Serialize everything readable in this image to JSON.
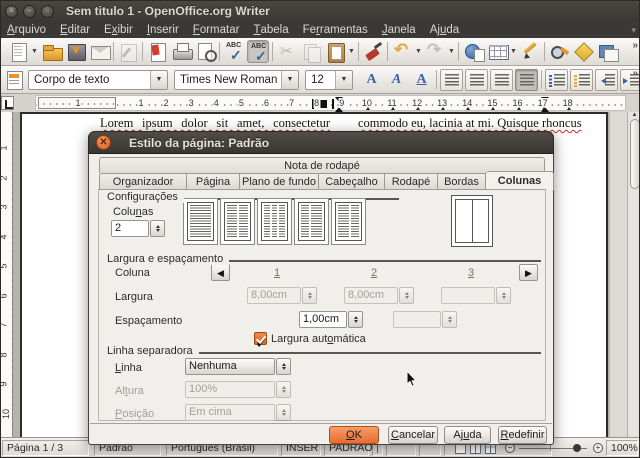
{
  "window": {
    "title": "Sem titulo 1 - OpenOffice.org Writer"
  },
  "colors": {
    "titlebar_background": "#3b3935",
    "accent_orange": "#e9662f",
    "ok_button_orange": "#ee8052",
    "toolbar_icon_blue": "#3465a4",
    "spellcheck_wave_red": "#cc2a1f",
    "dialog_background": "#f1efeb"
  },
  "menubar": {
    "items": [
      {
        "label": "Arquivo",
        "m": 0
      },
      {
        "label": "Editar",
        "m": 0
      },
      {
        "label": "Exibir",
        "m": 1
      },
      {
        "label": "Inserir",
        "m": 0
      },
      {
        "label": "Formatar",
        "m": 0
      },
      {
        "label": "Tabela",
        "m": 0
      },
      {
        "label": "Ferramentas",
        "m": 2
      },
      {
        "label": "Janela",
        "m": 0
      },
      {
        "label": "Ajuda",
        "m": 2
      }
    ]
  },
  "standard_toolbar": {
    "items": [
      {
        "name": "new-document",
        "type": "new",
        "dropdown": true
      },
      {
        "name": "open-document",
        "type": "open"
      },
      {
        "name": "save-document",
        "type": "save"
      },
      {
        "name": "email-document",
        "type": "mail"
      },
      {
        "sep": true
      },
      {
        "name": "edit-file",
        "type": "edit",
        "disabled": true
      },
      {
        "sep": true
      },
      {
        "name": "export-pdf",
        "type": "pdf"
      },
      {
        "name": "print",
        "type": "print"
      },
      {
        "name": "page-preview",
        "type": "preview"
      },
      {
        "sep": true
      },
      {
        "name": "spellcheck",
        "type": "spell"
      },
      {
        "name": "auto-spellcheck",
        "type": "autospell",
        "pressed": true
      },
      {
        "sep": true
      },
      {
        "name": "cut",
        "type": "cut",
        "disabled": true
      },
      {
        "name": "copy",
        "type": "copy",
        "disabled": true
      },
      {
        "name": "paste",
        "type": "paste",
        "dropdown": true
      },
      {
        "sep": true
      },
      {
        "name": "format-paintbrush",
        "type": "brush"
      },
      {
        "sep": true
      },
      {
        "name": "undo",
        "type": "undo",
        "dropdown": true
      },
      {
        "name": "redo",
        "type": "redo",
        "disabled": true,
        "dropdown": true
      },
      {
        "sep": true
      },
      {
        "name": "hyperlink",
        "type": "link"
      },
      {
        "name": "insert-table",
        "type": "table",
        "dropdown": true
      },
      {
        "name": "draw-functions",
        "type": "draw"
      },
      {
        "sep": true
      },
      {
        "name": "find-replace",
        "type": "find"
      },
      {
        "name": "navigator",
        "type": "nav"
      },
      {
        "name": "gallery",
        "type": "gallery"
      }
    ]
  },
  "formatting_toolbar": {
    "style_value": "Corpo de texto",
    "font_value": "Times New Roman",
    "size_value": "12",
    "buttons": [
      {
        "name": "bold",
        "glyph": "A",
        "cls": "b"
      },
      {
        "name": "italic",
        "glyph": "A",
        "cls": "i"
      },
      {
        "name": "underline",
        "glyph": "A",
        "cls": "u"
      },
      {
        "sep": true
      },
      {
        "name": "align-left",
        "cls": "boxed al"
      },
      {
        "name": "align-center",
        "cls": "boxed ac"
      },
      {
        "name": "align-right",
        "cls": "boxed ar"
      },
      {
        "name": "justify",
        "cls": "boxed aj",
        "pressed": true
      },
      {
        "sep": true
      },
      {
        "name": "numbered-list",
        "cls": "boxed listic"
      },
      {
        "name": "bullet-list",
        "cls": "boxed listic ul"
      },
      {
        "name": "decrease-indent",
        "cls": "boxed indent outd"
      },
      {
        "name": "increase-indent",
        "cls": "boxed indent ind"
      }
    ]
  },
  "ruler": {
    "margin_label": "1",
    "numbers": [
      "1",
      "2",
      "3",
      "4",
      "5",
      "6",
      "7",
      "8",
      "9",
      "10",
      "11",
      "12",
      "13",
      "14",
      "15",
      "16",
      "17",
      "18"
    ]
  },
  "vertical_ruler": {
    "numbers": [
      "1",
      "2",
      "3",
      "4",
      "5",
      "6",
      "7",
      "8",
      "9",
      "10"
    ]
  },
  "document": {
    "column1_text": "Lorem ipsum dolor sit amet, consectetur",
    "column2_text": "commodo eu, lacinia at mi. Quisque rhoncus"
  },
  "dialog": {
    "title": "Estilo da página: Padrão",
    "top_tab": "Nota de rodapé",
    "tabs": [
      "Organizador",
      "Página",
      "Plano de fundo",
      "Cabeçalho",
      "Rodapé",
      "Bordas",
      "Colunas"
    ],
    "active_tab": "Colunas",
    "settings": {
      "label": "Configurações",
      "columns_label": {
        "label": "Colunas",
        "m": 4
      },
      "columns_value": "2"
    },
    "width_section": {
      "label": "Largura e espaçamento",
      "column_label": "Coluna",
      "column_numbers": [
        "1",
        "2",
        "3"
      ],
      "width_label": "Largura",
      "width_values": [
        "8,00cm",
        "8,00cm",
        ""
      ],
      "spacing_label": "Espaçamento",
      "spacing_values": [
        "1,00cm",
        ""
      ],
      "auto_width": {
        "label": "Largura automática",
        "m": 11,
        "checked": true
      }
    },
    "separator_section": {
      "label": "Linha separadora",
      "line_label": {
        "label": "Linha",
        "m": 0
      },
      "line_value": "Nenhuma",
      "height_label": {
        "label": "Altura",
        "m": 2
      },
      "height_value": "100%",
      "position_label": {
        "label": "Posição",
        "m": 0
      },
      "position_value": "Em cima"
    },
    "buttons": [
      {
        "label": "OK",
        "m": 0,
        "primary": true
      },
      {
        "label": "Cancelar",
        "m": 0
      },
      {
        "label": "Ajuda",
        "m": 2
      },
      {
        "label": "Redefinir",
        "m": 0
      }
    ]
  },
  "statusbar": {
    "page": "Página 1 / 3",
    "style": "Padrão",
    "language": "Português (Brasil)",
    "insert_mode": "INSER",
    "selection_mode": "PADRAO",
    "zoom": "100%"
  }
}
